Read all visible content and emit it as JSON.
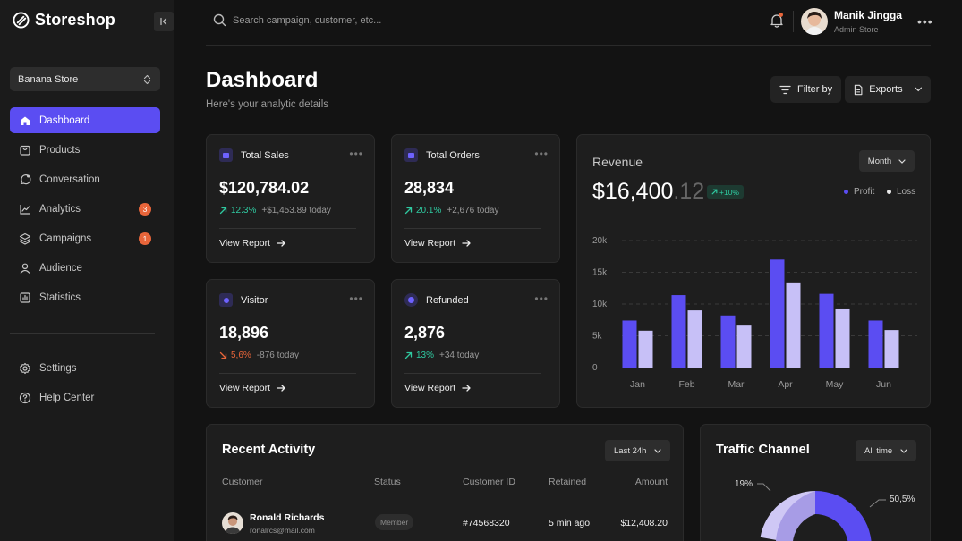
{
  "brand": {
    "name": "Storeshop"
  },
  "store_select": {
    "value": "Banana Store"
  },
  "nav": {
    "items": [
      {
        "label": "Dashboard",
        "icon": "home-icon",
        "active": true
      },
      {
        "label": "Products",
        "icon": "shopping-bag-icon"
      },
      {
        "label": "Conversation",
        "icon": "chat-icon"
      },
      {
        "label": "Analytics",
        "icon": "trend-icon",
        "badge": "3"
      },
      {
        "label": "Campaigns",
        "icon": "layers-icon",
        "badge": "1"
      },
      {
        "label": "Audience",
        "icon": "user-icon"
      },
      {
        "label": "Statistics",
        "icon": "bar-chart-icon"
      }
    ],
    "bottom": [
      {
        "label": "Settings",
        "icon": "gear-icon"
      },
      {
        "label": "Help Center",
        "icon": "help-icon"
      }
    ]
  },
  "search": {
    "placeholder": "Search campaign, customer, etc..."
  },
  "user": {
    "name": "Manik Jingga",
    "role": "Admin Store"
  },
  "header": {
    "title": "Dashboard",
    "subtitle": "Here's your analytic details",
    "filter_label": "Filter by",
    "exports_label": "Exports"
  },
  "stats": [
    {
      "title": "Total Sales",
      "value": "$120,784.02",
      "pct": "12.3%",
      "direction": "up",
      "today": "+$1,453.89 today",
      "link": "View Report"
    },
    {
      "title": "Total Orders",
      "value": "28,834",
      "pct": "20.1%",
      "direction": "up",
      "today": "+2,676 today",
      "link": "View Report"
    },
    {
      "title": "Visitor",
      "value": "18,896",
      "pct": "5,6%",
      "direction": "down",
      "today": "-876 today",
      "link": "View Report"
    },
    {
      "title": "Refunded",
      "value": "2,876",
      "pct": "13%",
      "direction": "up",
      "today": "+34 today",
      "link": "View Report"
    }
  ],
  "revenue": {
    "title": "Revenue",
    "period": "Month",
    "value_main": "$16,400",
    "value_decimal": ".12",
    "badge": "+10%",
    "legend": {
      "profit": "Profit",
      "loss": "Loss"
    }
  },
  "chart_data": {
    "type": "bar",
    "categories": [
      "Jan",
      "Feb",
      "Mar",
      "Apr",
      "May",
      "Jun"
    ],
    "series": [
      {
        "name": "Profit",
        "color": "#5b4df2",
        "values": [
          7400,
          11400,
          8200,
          17000,
          11600,
          7400
        ]
      },
      {
        "name": "Loss",
        "color": "#c7c0f7",
        "values": [
          5800,
          9000,
          6600,
          13400,
          9300,
          5900
        ]
      }
    ],
    "yticks": [
      "0",
      "5k",
      "10k",
      "15k",
      "20k"
    ],
    "ylim": [
      0,
      20000
    ],
    "grid": true
  },
  "activity": {
    "title": "Recent Activity",
    "period": "Last 24h",
    "columns": [
      "Customer",
      "Status",
      "Customer ID",
      "Retained",
      "Amount"
    ],
    "rows": [
      {
        "name": "Ronald Richards",
        "email": "ronalrcs@mail.com",
        "status": "Member",
        "customer_id": "#74568320",
        "retained": "5 min ago",
        "amount": "$12,408.20"
      }
    ]
  },
  "traffic": {
    "title": "Traffic Channel",
    "period": "All time",
    "labels": [
      "19%",
      "50,5%"
    ],
    "colors": {
      "primary": "#5b4df2",
      "secondary": "#a79ce6",
      "tertiary": "#cfc8f5"
    }
  }
}
